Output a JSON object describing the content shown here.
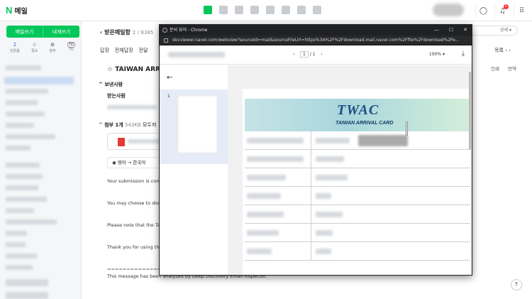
{
  "app": {
    "logo": "N",
    "title": "메일"
  },
  "topbar": {
    "notif_count": "1"
  },
  "sidebar": {
    "write_label": "메일쓰기",
    "self_label": "내게쓰기",
    "quick": [
      {
        "value": "2",
        "label": "안읽음",
        "icon": "unread-count"
      },
      {
        "value": "☆",
        "label": "중요",
        "icon": "star-icon"
      },
      {
        "value": "⊘",
        "label": "첨부",
        "icon": "paperclip-icon"
      },
      {
        "value": "TO",
        "label": "TO",
        "icon": "to-icon"
      }
    ]
  },
  "mail": {
    "breadcrumb": "받은메일함",
    "count_current": "2",
    "count_total": "/ 8385",
    "search_placeholder": "상세 ▾",
    "toolbar": [
      "답장",
      "전체답장",
      "전달"
    ],
    "list_label": "목록",
    "subject": "TAIWAN ARRIVAL",
    "sender_label": "보낸사람",
    "receiver_label": "받는사람",
    "attach_label": "첨부 1개",
    "attach_size": "543KB",
    "attach_all": "모두저",
    "translate": "영어 → 한국어",
    "print_label": "인쇄",
    "translate_label": "번역",
    "body": [
      "Your submission is compl",
      "You may choose to dowr",
      "Please note that the Taiw",
      "Thank you for using the T",
      "This message has been analyzed by Deep Discovery Email Inspector."
    ],
    "divider": "==================",
    "scroll_top": "↑"
  },
  "popup": {
    "title": "문서 뷰어 - Chrome",
    "url": "docviewer.naver.com/webview?sourceId=mail&sourceFileUrl=https%3A%2F%2Fdownload.mail.naver.com%2Ffile%2Fdownload%2Fe...",
    "page_current": "1",
    "page_sep": "/",
    "page_total": "1",
    "zoom": "100%",
    "zoom_caret": "▾",
    "download_icon": "⤓",
    "thumb_number": "1",
    "back_arrow": "←",
    "card_logo": "TWAC",
    "card_title": "TAIWAN ARRIVAL CARD",
    "window_controls": [
      "—",
      "☐",
      "✕"
    ]
  }
}
